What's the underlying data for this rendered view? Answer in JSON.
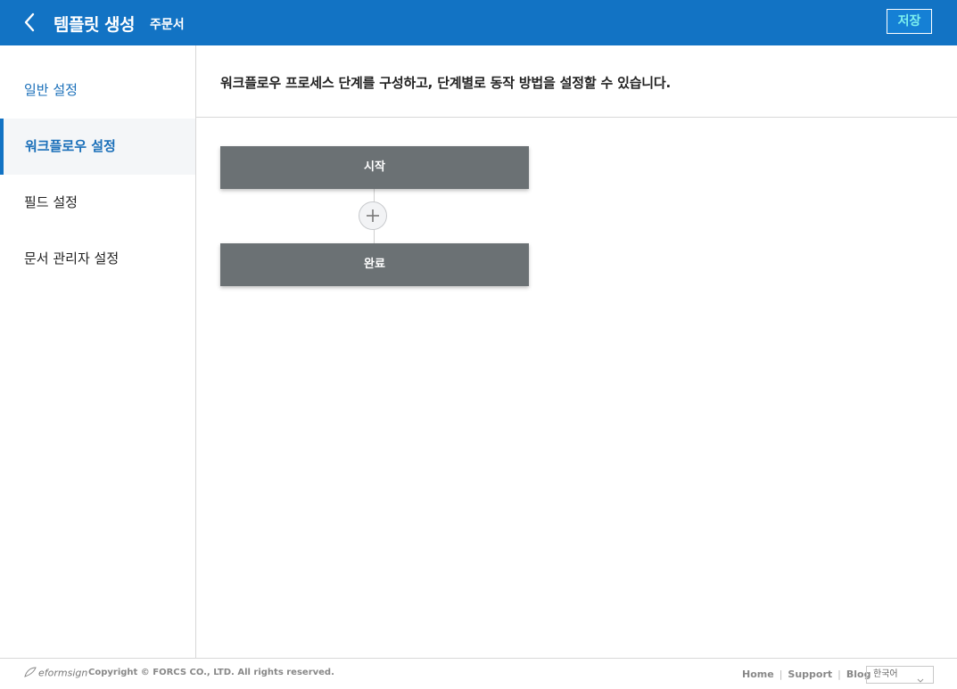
{
  "header": {
    "title": "템플릿 생성",
    "subtitle": "주문서",
    "save_label": "저장",
    "back_icon": "chevron-left-icon"
  },
  "sidebar": {
    "items": [
      {
        "label": "일반 설정"
      },
      {
        "label": "워크플로우 설정",
        "active": true
      },
      {
        "label": "필드 설정"
      },
      {
        "label": "문서 관리자 설정"
      }
    ]
  },
  "main": {
    "description": "워크플로우 프로세스 단계를 구성하고, 단계별로 동작 방법을 설정할 수 있습니다.",
    "steps": [
      {
        "label": "시작"
      },
      {
        "label": "완료"
      }
    ],
    "add_icon": "plus-icon"
  },
  "footer": {
    "brand": "eformsign",
    "copyright": "Copyright © FORCS CO., LTD. All rights reserved.",
    "links": [
      "Home",
      "Support",
      "Blog"
    ],
    "language": "한국어"
  },
  "colors": {
    "header_bg": "#1273c4",
    "accent": "#1a6fb9",
    "step_bg": "#6b7174",
    "save_text": "#7cf0ee"
  }
}
